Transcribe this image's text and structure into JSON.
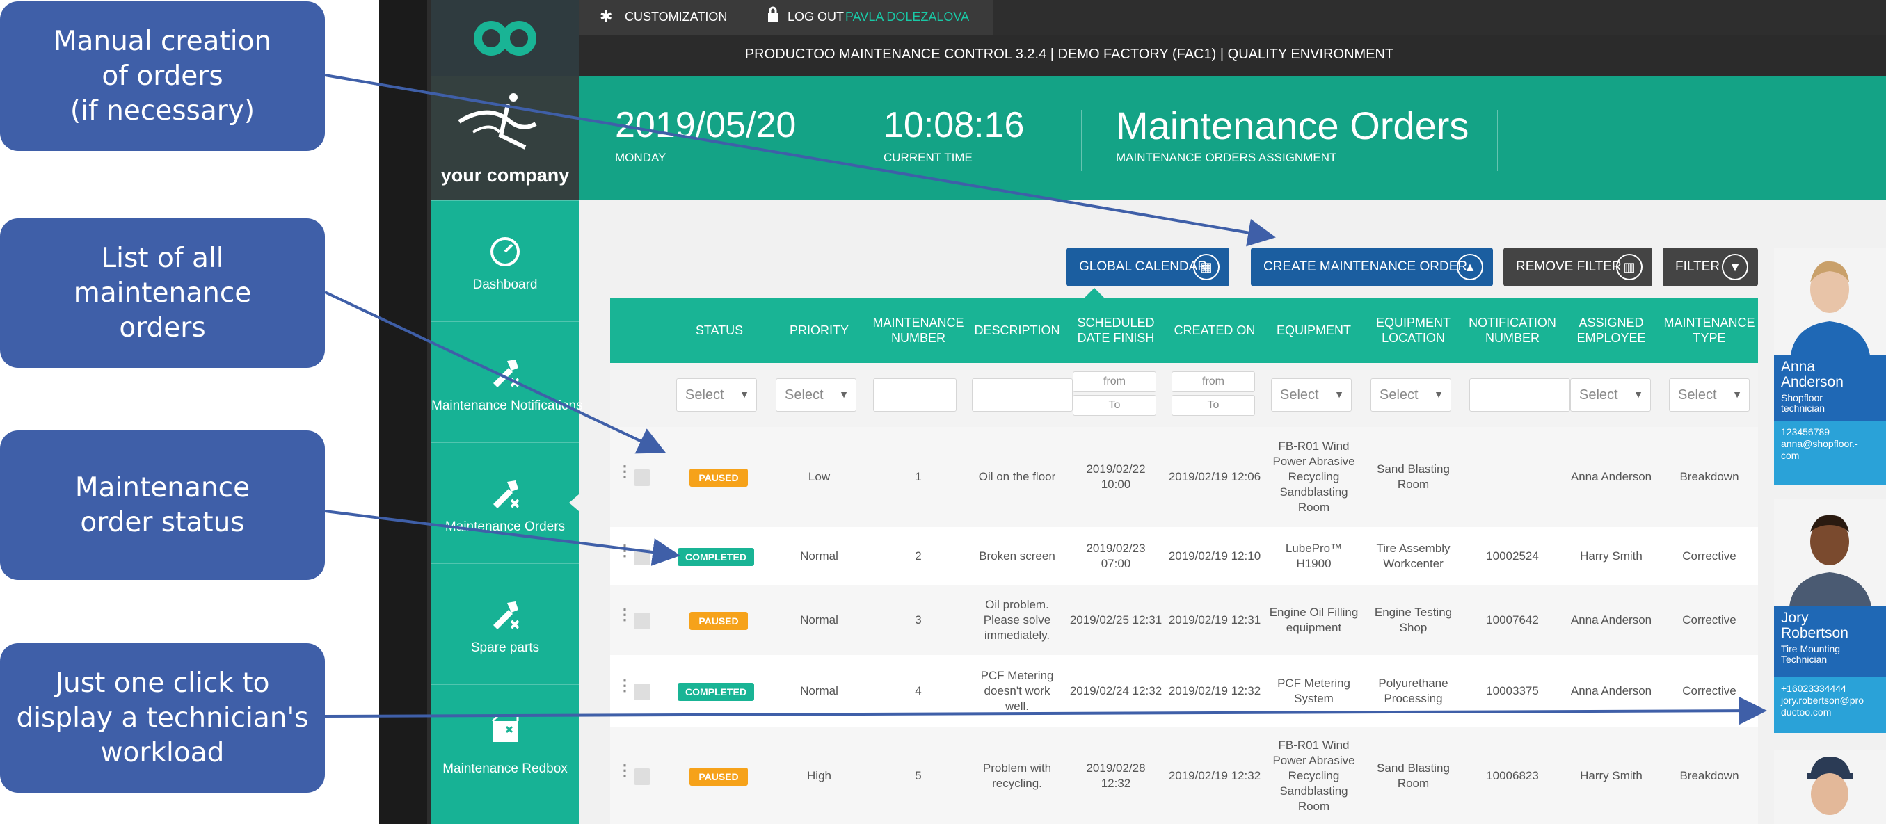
{
  "callouts": [
    {
      "text": "Manual creation\nof orders\n(if necessary)"
    },
    {
      "text": "List of all\nmaintenance\norders"
    },
    {
      "text": "Maintenance\norder status"
    },
    {
      "text": "Just one click to\ndisplay a technician's\nworkload"
    }
  ],
  "topbar": {
    "customization": "CUSTOMIZATION",
    "logout": "LOG OUT",
    "user": "PAVLA DOLEZALOVA",
    "system_title": "PRODUCTOO MAINTENANCE CONTROL 3.2.4 | DEMO FACTORY (FAC1) | QUALITY ENVIRONMENT"
  },
  "sidebar": {
    "company": "your company",
    "items": [
      {
        "label": "Dashboard",
        "icon": "speedometer-icon"
      },
      {
        "label": "Maintenance Notifications",
        "icon": "tools-icon"
      },
      {
        "label": "Maintenance Orders",
        "icon": "tools-icon"
      },
      {
        "label": "Spare parts",
        "icon": "tools-icon"
      },
      {
        "label": "Maintenance Redbox",
        "icon": "box-icon"
      }
    ]
  },
  "header": {
    "date": "2019/05/20",
    "weekday": "MONDAY",
    "time": "10:08:16",
    "time_label": "CURRENT TIME",
    "title": "Maintenance Orders",
    "subtitle": "MAINTENANCE ORDERS ASSIGNMENT"
  },
  "buttons": {
    "global_calendar": "GLOBAL CALENDAR",
    "create_order": "CREATE MAINTENANCE ORDER",
    "remove_filter": "REMOVE FILTER",
    "filter": "FILTER"
  },
  "table": {
    "columns": [
      "STATUS",
      "PRIORITY",
      "MAINTENANCE\nNUMBER",
      "DESCRIPTION",
      "SCHEDULED\nDATE FINISH",
      "CREATED ON",
      "EQUIPMENT",
      "EQUIPMENT\nLOCATION",
      "NOTIFICATION\nNUMBER",
      "ASSIGNED\nEMPLOYEE",
      "MAINTENANCE\nTYPE"
    ],
    "filters": {
      "select": "Select",
      "from": "from",
      "to": "To"
    },
    "rows": [
      {
        "status": "PAUSED",
        "priority": "Low",
        "number": "1",
        "description": "Oil on the floor",
        "scheduled": "2019/02/22\n10:00",
        "created": "2019/02/19 12:06",
        "equipment": "FB-R01 Wind\nPower Abrasive\nRecycling\nSandblasting\nRoom",
        "location": "Sand Blasting\nRoom",
        "notification": "",
        "employee": "Anna Anderson",
        "type": "Breakdown"
      },
      {
        "status": "COMPLETED",
        "priority": "Normal",
        "number": "2",
        "description": "Broken screen",
        "scheduled": "2019/02/23\n07:00",
        "created": "2019/02/19 12:10",
        "equipment": "LubePro™\nH1900",
        "location": "Tire Assembly\nWorkcenter",
        "notification": "10002524",
        "employee": "Harry Smith",
        "type": "Corrective"
      },
      {
        "status": "PAUSED",
        "priority": "Normal",
        "number": "3",
        "description": "Oil problem.\nPlease solve\nimmediately.",
        "scheduled": "2019/02/25 12:31",
        "created": "2019/02/19 12:31",
        "equipment": "Engine Oil Filling\nequipment",
        "location": "Engine Testing\nShop",
        "notification": "10007642",
        "employee": "Anna Anderson",
        "type": "Corrective"
      },
      {
        "status": "COMPLETED",
        "priority": "Normal",
        "number": "4",
        "description": "PCF Metering\ndoesn't work\nwell.",
        "scheduled": "2019/02/24 12:32",
        "created": "2019/02/19 12:32",
        "equipment": "PCF Metering\nSystem",
        "location": "Polyurethane\nProcessing",
        "notification": "10003375",
        "employee": "Anna Anderson",
        "type": "Corrective"
      },
      {
        "status": "PAUSED",
        "priority": "High",
        "number": "5",
        "description": "Problem with\nrecycling.",
        "scheduled": "2019/02/28\n12:32",
        "created": "2019/02/19 12:32",
        "equipment": "FB-R01 Wind\nPower Abrasive\nRecycling\nSandblasting\nRoom",
        "location": "Sand Blasting\nRoom",
        "notification": "10006823",
        "employee": "Harry Smith",
        "type": "Breakdown"
      }
    ]
  },
  "employees": [
    {
      "name": "Anna\nAnderson",
      "role": "Shopfloor\ntechnician",
      "contact": "123456789\nanna@shopfloor.-\ncom"
    },
    {
      "name": "Jory\nRobertson",
      "role": "Tire Mounting\nTechnician",
      "contact": "+16023334444\njory.robertson@pro\nductoo.com"
    },
    {
      "name": "",
      "role": "",
      "contact": ""
    }
  ],
  "colors": {
    "callout": "#3f5fa8",
    "teal": "#19b495",
    "paused": "#f6a21a",
    "completed": "#19b495",
    "button_blue": "#1b5ea0"
  }
}
